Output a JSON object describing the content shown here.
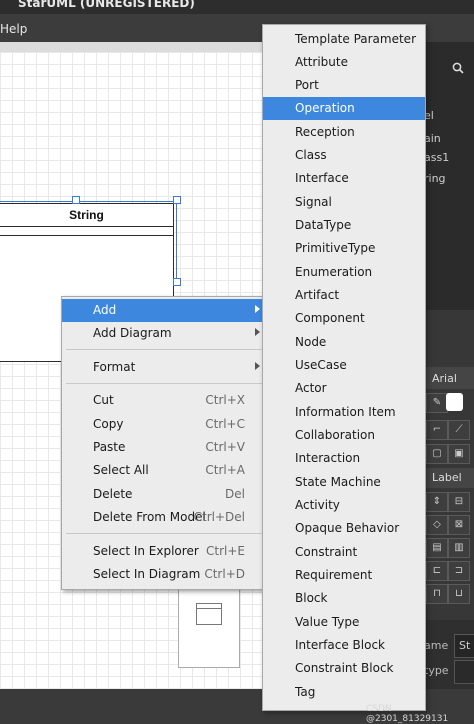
{
  "window": {
    "title": "StarUML (UNREGISTERED)"
  },
  "menubar": {
    "visible_item": "Help"
  },
  "diagram": {
    "class_name": "String"
  },
  "context_menu": {
    "items": [
      {
        "label": "Add",
        "shortcut": "",
        "submenu": true,
        "active": true
      },
      {
        "label": "Add Diagram",
        "shortcut": "",
        "submenu": true
      },
      {
        "label": "Format",
        "shortcut": "",
        "submenu": true
      },
      {
        "label": "Cut",
        "shortcut": "Ctrl+X"
      },
      {
        "label": "Copy",
        "shortcut": "Ctrl+C"
      },
      {
        "label": "Paste",
        "shortcut": "Ctrl+V"
      },
      {
        "label": "Select All",
        "shortcut": "Ctrl+A"
      },
      {
        "label": "Delete",
        "shortcut": "Del"
      },
      {
        "label": "Delete From Model",
        "shortcut": "Ctrl+Del"
      },
      {
        "label": "Select In Explorer",
        "shortcut": "Ctrl+E"
      },
      {
        "label": "Select In Diagram",
        "shortcut": "Ctrl+D"
      }
    ]
  },
  "add_submenu": {
    "items": [
      "Template Parameter",
      "Attribute",
      "Port",
      "Operation",
      "Reception",
      "Class",
      "Interface",
      "Signal",
      "DataType",
      "PrimitiveType",
      "Enumeration",
      "Artifact",
      "Component",
      "Node",
      "UseCase",
      "Actor",
      "Information Item",
      "Collaboration",
      "Interaction",
      "State Machine",
      "Activity",
      "Opaque Behavior",
      "Constraint",
      "Requirement",
      "Block",
      "Value Type",
      "Interface Block",
      "Constraint Block",
      "Tag"
    ],
    "active_item": "Operation"
  },
  "right_panel": {
    "partial_texts": [
      "el",
      "ain",
      "ass1",
      "ring"
    ],
    "font": "Arial",
    "label_tab": "Label",
    "field_name": "ame",
    "field_type": "type",
    "field_value": "St"
  },
  "watermark": "CSDN @2301_81329131",
  "colors": {
    "highlight": "#3d87de",
    "menu_bg": "#ececec"
  }
}
